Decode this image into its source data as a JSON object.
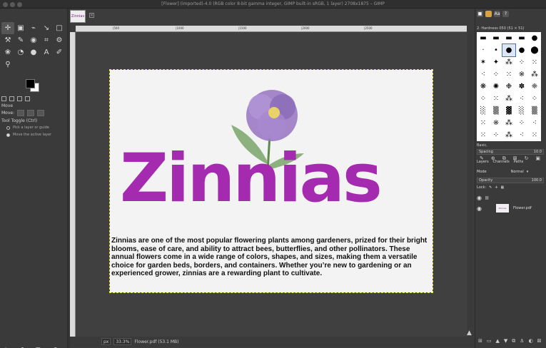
{
  "window": {
    "title": "[Flower] (imported)-4.0 (RGB color 8-bit gamma integer, GIMP built-in sRGB, 1 layer) 2708x1875 – GIMP"
  },
  "toolbox": {
    "tools": [
      "✛",
      "▣",
      "⌁",
      "↘",
      "□",
      "⚒",
      "✎",
      "◉",
      "⌗",
      "⚙",
      "❀",
      "◔",
      "●",
      "A",
      "✐",
      "⚲"
    ],
    "tool_options_title": "Move",
    "move_label": "Move:",
    "tool_toggle_label": "Tool Toggle  (Ctrl)",
    "option_pick": "Pick a layer or guide",
    "option_move_active": "Move the active layer"
  },
  "canvas": {
    "tab_label": "Zinnias",
    "ruler_ticks": [
      "|500",
      "|1000",
      "|1500",
      "|2000",
      "|2500"
    ],
    "document": {
      "heading": "Zinnias",
      "paragraph": "Zinnias are one of the most popular flowering plants among gardeners, prized for their bright blooms, ease of care, and ability to attract bees, butterflies, and other pollinators. These annual flowers come in a wide range of colors, shapes, and sizes, making them a versatile choice for garden beds, borders, and containers. Whether you’re new to gardening or an experienced grower, zinnias are a rewarding plant to cultivate.",
      "heading_color": "#a42ab0"
    }
  },
  "statusbar": {
    "unit": "px",
    "zoom": "33.3%",
    "file_info": "Flower.pdf (53.1 MB)"
  },
  "dock": {
    "brush_name": "2. Hardness 050 (51 × 51)",
    "preset_label": "Basic,",
    "spacing_label": "Spacing",
    "spacing_value": "10.0",
    "tabs": {
      "layers": "Layers",
      "channels": "Channels",
      "paths": "Paths"
    },
    "mode_label": "Mode",
    "mode_value": "Normal",
    "opacity_label": "Opacity",
    "opacity_value": "100.0",
    "lock_label": "Lock:",
    "layer_name": "Flower.pdf"
  }
}
